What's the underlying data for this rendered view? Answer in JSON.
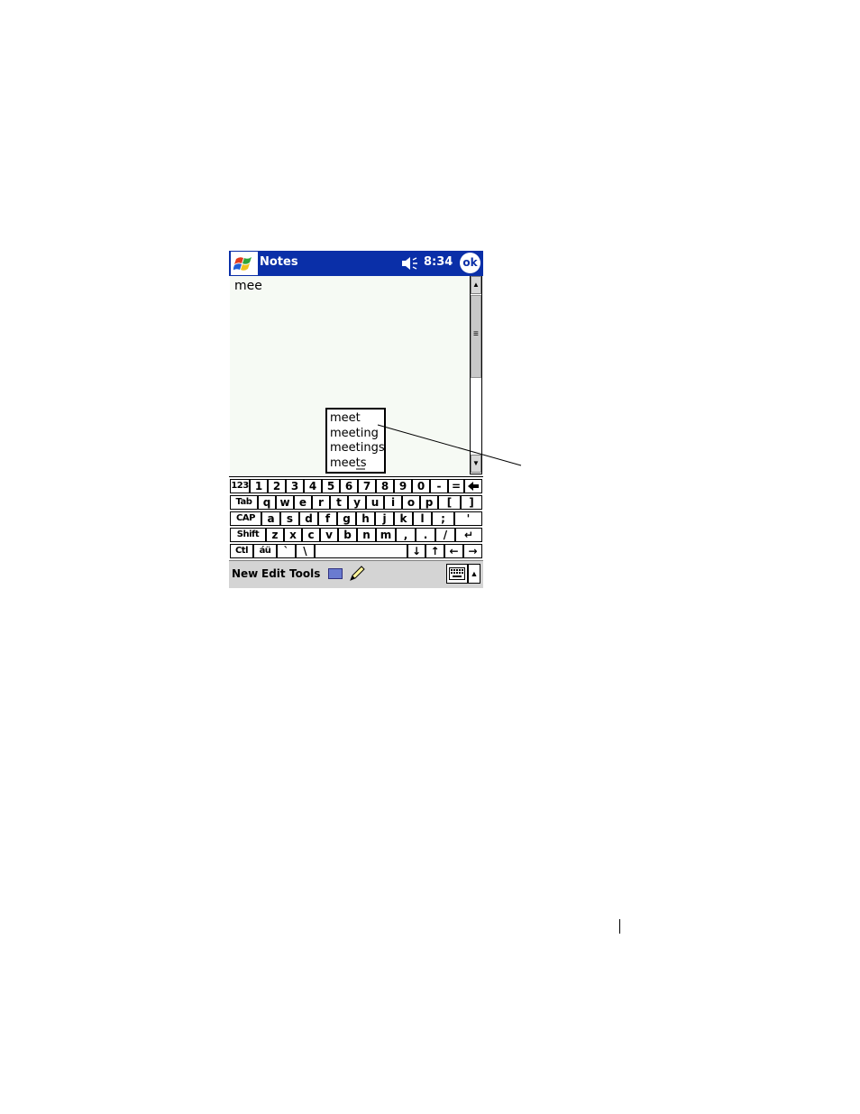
{
  "titlebar": {
    "app_title": "Notes",
    "clock": "8:34",
    "ok_label": "ok",
    "bg_color": "#0a2fa8"
  },
  "note": {
    "text": "mee"
  },
  "suggestions": [
    "meet",
    "meeting",
    "meetings",
    "meets"
  ],
  "keyboard": {
    "rows": [
      [
        "123",
        "1",
        "2",
        "3",
        "4",
        "5",
        "6",
        "7",
        "8",
        "9",
        "0",
        "-",
        "=",
        "🡐"
      ],
      [
        "Tab",
        "q",
        "w",
        "e",
        "r",
        "t",
        "y",
        "u",
        "i",
        "o",
        "p",
        "[",
        "]"
      ],
      [
        "CAP",
        "a",
        "s",
        "d",
        "f",
        "g",
        "h",
        "j",
        "k",
        "l",
        ";",
        "'"
      ],
      [
        "Shift",
        "z",
        "x",
        "c",
        "v",
        "b",
        "n",
        "m",
        ",",
        ".",
        "/",
        "↵"
      ],
      [
        "Ctl",
        "áü",
        "`",
        "\\",
        "",
        "↓",
        "↑",
        "←",
        "→"
      ]
    ]
  },
  "menubar": {
    "new": "New",
    "edit": "Edit",
    "tools": "Tools"
  },
  "icons": {
    "start": "windows-flag-icon",
    "volume": "speaker-icon",
    "recorder": "recorder-icon",
    "pen": "pen-icon",
    "keyboard": "keyboard-icon",
    "sip_arrow": "up-arrow-icon"
  }
}
